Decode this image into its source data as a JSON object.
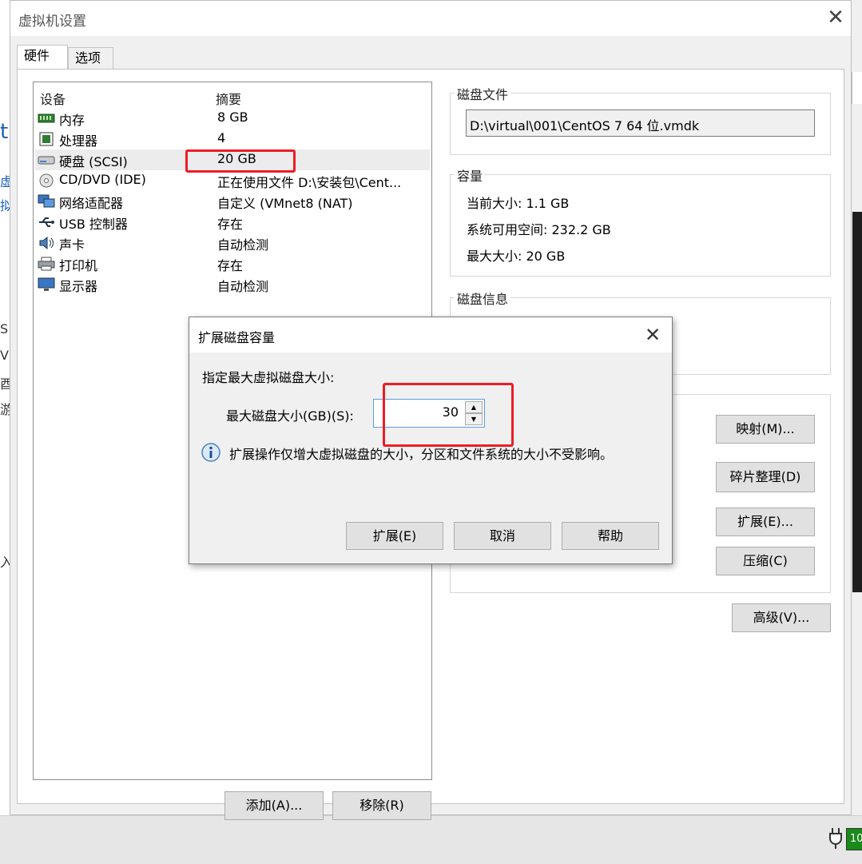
{
  "window": {
    "title": "虚拟机设置",
    "close_glyph": "✕"
  },
  "tabs": [
    {
      "label": "硬件",
      "active": true
    },
    {
      "label": "选项",
      "active": false
    }
  ],
  "device_list": {
    "header_device": "设备",
    "header_summary": "摘要",
    "rows": [
      {
        "name": "内存",
        "summary": "8 GB",
        "icon": "memory-icon"
      },
      {
        "name": "处理器",
        "summary": "4",
        "icon": "cpu-icon"
      },
      {
        "name": "硬盘 (SCSI)",
        "summary": "20 GB",
        "icon": "hard-disk-icon",
        "selected": true
      },
      {
        "name": "CD/DVD (IDE)",
        "summary": "正在使用文件 D:\\安装包\\Cent...",
        "icon": "cd-dvd-icon"
      },
      {
        "name": "网络适配器",
        "summary": "自定义 (VMnet8 (NAT)",
        "icon": "network-adapter-icon"
      },
      {
        "name": "USB 控制器",
        "summary": "存在",
        "icon": "usb-icon"
      },
      {
        "name": "声卡",
        "summary": "自动检测",
        "icon": "speaker-icon"
      },
      {
        "name": "打印机",
        "summary": "存在",
        "icon": "printer-icon"
      },
      {
        "name": "显示器",
        "summary": "自动检测",
        "icon": "monitor-icon"
      }
    ]
  },
  "buttons": {
    "add": "添加(A)...",
    "remove": "移除(R)",
    "map": "映射(M)...",
    "defrag": "碎片整理(D)",
    "expand": "扩展(E)...",
    "compact": "压缩(C)",
    "advanced": "高级(V)..."
  },
  "disk_file": {
    "label": "磁盘文件",
    "value": "D:\\virtual\\001\\CentOS 7 64 位.vmdk"
  },
  "capacity": {
    "label": "容量",
    "current_size": "当前大小: 1.1 GB",
    "available": "系统可用空间: 232.2 GB",
    "max_size": "最大大小: 20 GB"
  },
  "disk_info": {
    "label": "磁盘信息"
  },
  "expand_dialog": {
    "title": "扩展磁盘容量",
    "close_glyph": "✕",
    "prompt": "指定最大虚拟磁盘大小:",
    "field_label": "最大磁盘大小(GB)(S):",
    "field_value": "30",
    "info_text": "扩展操作仅增大虚拟磁盘的大小，分区和文件系统的大小不受影响。",
    "btn_expand": "扩展(E)",
    "btn_cancel": "取消",
    "btn_help": "帮助"
  },
  "taskbar": {
    "battery_text": "10"
  }
}
